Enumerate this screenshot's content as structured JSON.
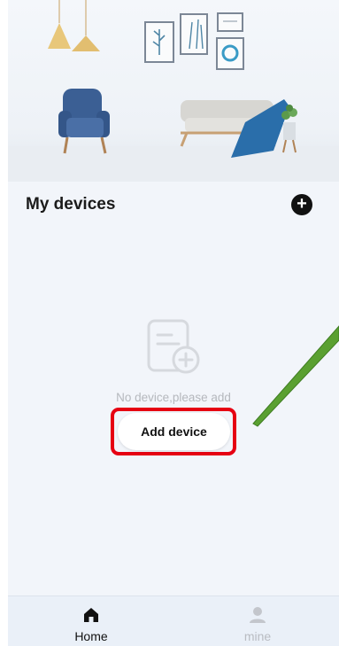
{
  "devices": {
    "title": "My devices",
    "add_icon": "plus-circle-icon",
    "empty_icon": "document-add-icon",
    "empty_text": "No device,please add",
    "add_button_label": "Add device"
  },
  "annotation": {
    "highlight_color": "#e60012",
    "pointer_color": "#5aa031"
  },
  "nav": {
    "items": [
      {
        "label": "Home",
        "icon": "home-icon",
        "active": true
      },
      {
        "label": "mine",
        "icon": "user-icon",
        "active": false
      }
    ]
  }
}
